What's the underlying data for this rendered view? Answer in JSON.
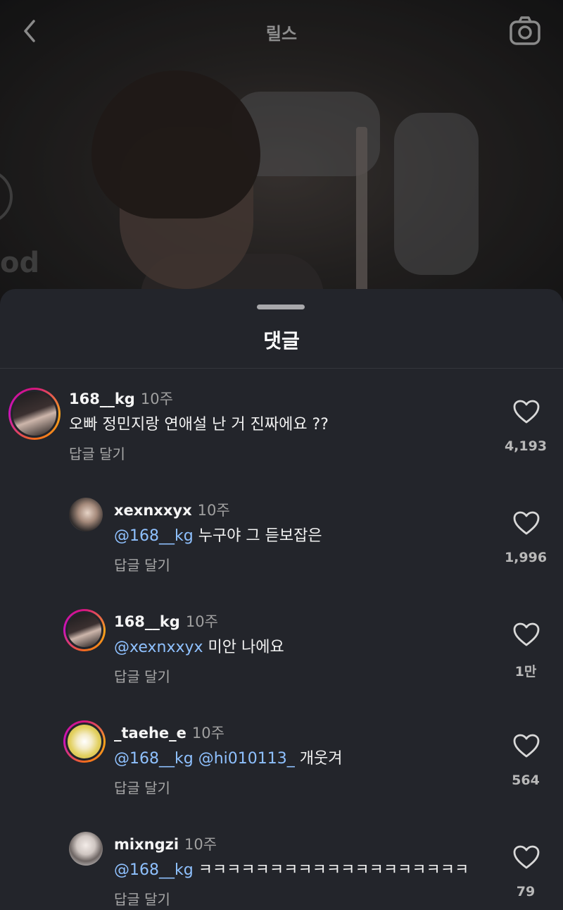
{
  "header": {
    "title": "릴스",
    "back_icon": "chevron-left-icon",
    "camera_icon": "camera-icon"
  },
  "sheet": {
    "title": "댓글"
  },
  "comments": [
    {
      "username": "168__kg",
      "time": "10주",
      "mention": "",
      "text": "오빠 정민지랑 연애설 난 거 진짜에요 ??",
      "reply_label": "답글 달기",
      "likes": "4,193",
      "avatar_ring": true
    },
    {
      "username": "xexnxxyx",
      "time": "10주",
      "mention": "@168__kg",
      "text": " 누구야 그 듣보잡은",
      "reply_label": "답글 달기",
      "likes": "1,996",
      "avatar_ring": false
    },
    {
      "username": "168__kg",
      "time": "10주",
      "mention": "@xexnxxyx",
      "text": " 미안 나에요",
      "reply_label": "답글 달기",
      "likes": "1만",
      "avatar_ring": true
    },
    {
      "username": "_taehe_e",
      "time": "10주",
      "mention": "@168__kg @hi010113_",
      "text": " 개웃겨",
      "reply_label": "답글 달기",
      "likes": "564",
      "avatar_ring": true
    },
    {
      "username": "mixngzi",
      "time": "10주",
      "mention": "@168__kg",
      "text": " ㅋㅋㅋㅋㅋㅋㅋㅋㅋㅋㅋㅋㅋㅋㅋㅋㅋㅋㅋ",
      "reply_label": "답글 달기",
      "likes": "79",
      "avatar_ring": false
    }
  ],
  "colors": {
    "sheet_bg": "#23252b",
    "mention": "#8fc1ff",
    "ring_start": "#d4157f",
    "ring_end": "#f7a41d"
  }
}
